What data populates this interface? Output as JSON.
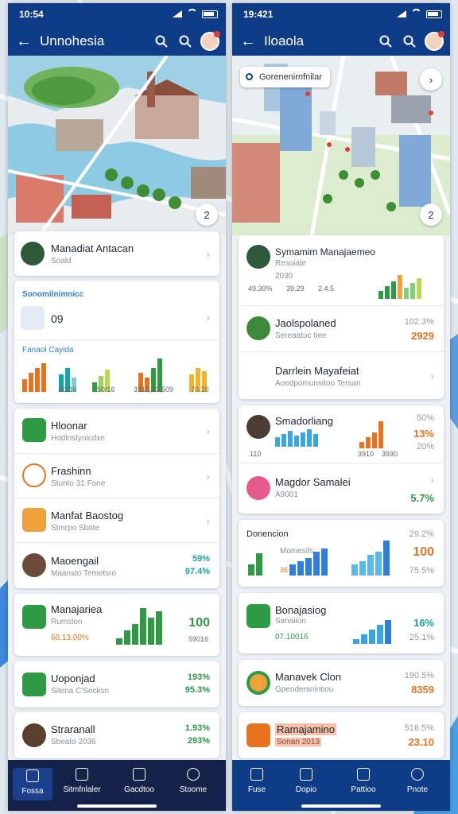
{
  "left": {
    "status_time": "10:54",
    "title": "Unnohesia",
    "map_badge": "2",
    "card1": {
      "title": "Manadiat Antacan",
      "sub": "Soald"
    },
    "card2": {
      "header": "Sonomilnimnicc",
      "value": "09",
      "section": "Fanaol Cayida",
      "labels": [
        "50/16",
        "50/16",
        "3310,13,509",
        "70.10"
      ]
    },
    "list": [
      {
        "title": "Hloonar",
        "sub": "Hodinstynicdxe"
      },
      {
        "title": "Frashinn",
        "sub": "Stunto 31 Fone"
      },
      {
        "title": "Manfat Baostog",
        "sub": "Stmrpo Sbote"
      },
      {
        "title": "Maoengail",
        "sub": "Maansto Temetsro",
        "v1": "59%",
        "v2": "97.4%"
      }
    ],
    "stats": [
      {
        "title": "Manajariea",
        "sub": "Rumslon",
        "note": "60.13.00%",
        "value": "100",
        "small": "59016"
      },
      {
        "title": "Uoponjad",
        "sub": "Sitena C'Secksn",
        "v1": "193%",
        "v2": "95.3%"
      },
      {
        "title": "Straranall",
        "sub": "Sbeato 2036",
        "v1": "1.93%",
        "v2": "293%"
      }
    ],
    "nav": [
      "Fossa",
      "Sitmfnlaler",
      "Gacdtoo",
      "Stoome"
    ]
  },
  "right": {
    "status_time": "19:421",
    "title": "Iloaola",
    "map_search": "Gorenenirnfnilar",
    "map_badge": "2",
    "card1": [
      {
        "title": "Symamim Manajaemeo",
        "sub": "Resoiale",
        "extra": "2030",
        "pcts": [
          "49.30%",
          "39.29",
          "2.4.5"
        ]
      },
      {
        "title": "Jaolspolaned",
        "sub": "Sereaatoc tiee",
        "v1": "102.3%",
        "v2": "2929"
      },
      {
        "title": "Darrlein Mayafeiat",
        "sub": "Aoedpomunsitoo Tersan"
      }
    ],
    "card2": [
      {
        "title": "Smadorliang",
        "sub": "110",
        "labels": [
          "3910",
          "3930"
        ],
        "v1": "50%",
        "v2": "13%",
        "v3": "20%"
      },
      {
        "title": "Magdor Samalei",
        "sub": "A9001",
        "v1": "5.7%"
      }
    ],
    "card3": {
      "header": "Donencion",
      "sub": "Momesils",
      "value": "100",
      "v1": "29.2%",
      "v2": "75.5%",
      "label": "36"
    },
    "card4": {
      "title": "Bonajasiog",
      "sub": "Sanaiion",
      "note": "07.10016",
      "v1": "16%",
      "v2": "25.1%"
    },
    "card5": {
      "title": "Manavek Clon",
      "sub": "Gpeodersnintiou",
      "v1": "190.5%",
      "v2": "8359"
    },
    "card6": {
      "title": "Ramajamino",
      "sub": "Sonan 2013",
      "v1": "516.5%",
      "v2": "23.10"
    },
    "nav": [
      "Fuse",
      "Dopio",
      "Pattioo",
      "Pnote"
    ]
  },
  "colors": {
    "brand": "#0f3c86",
    "green": "#2e9a44",
    "orange": "#e8731e",
    "teal": "#14a3a6",
    "blue": "#2f7fd6"
  }
}
